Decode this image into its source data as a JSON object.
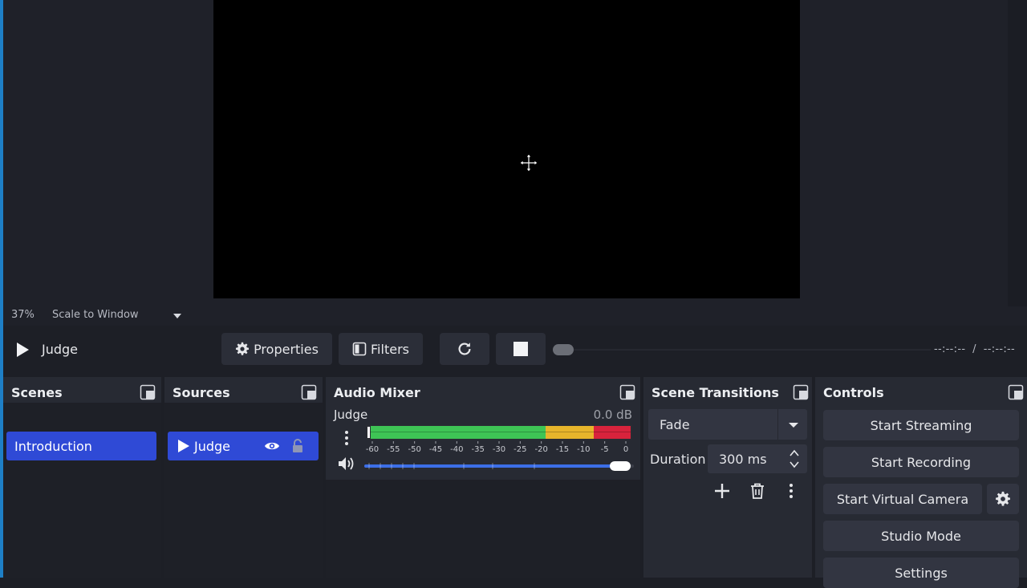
{
  "preview": {
    "zoom_percent": "37%",
    "scale_mode": "Scale to Window"
  },
  "toolbar": {
    "current_source": "Judge",
    "properties_label": "Properties",
    "filters_label": "Filters",
    "time_readout": "--:--:--  /  --:--:--",
    "seek_position": 0
  },
  "scenes": {
    "title": "Scenes",
    "items": [
      {
        "name": "Introduction",
        "selected": true
      }
    ]
  },
  "sources": {
    "title": "Sources",
    "items": [
      {
        "name": "Judge",
        "visible": true,
        "locked": false
      }
    ]
  },
  "mixer": {
    "title": "Audio Mixer",
    "channels": [
      {
        "name": "Judge",
        "level_db": "0.0 dB",
        "scale_ticks": [
          "-60",
          "-55",
          "-50",
          "-45",
          "-40",
          "-35",
          "-30",
          "-25",
          "-20",
          "-15",
          "-10",
          "-5",
          "0"
        ],
        "volume_fraction": 1.0
      }
    ]
  },
  "transitions": {
    "title": "Scene Transitions",
    "selected": "Fade",
    "duration_label": "Duration",
    "duration_value": "300 ms"
  },
  "controls": {
    "title": "Controls",
    "start_streaming": "Start Streaming",
    "start_recording": "Start Recording",
    "start_virtual_camera": "Start Virtual Camera",
    "studio_mode": "Studio Mode",
    "settings": "Settings"
  },
  "colors": {
    "selection": "#2f4ad6",
    "meter_green": "#3ec455",
    "meter_yellow": "#e7b52b",
    "meter_red": "#d8233c",
    "fader_fill": "#3c6ee6"
  }
}
